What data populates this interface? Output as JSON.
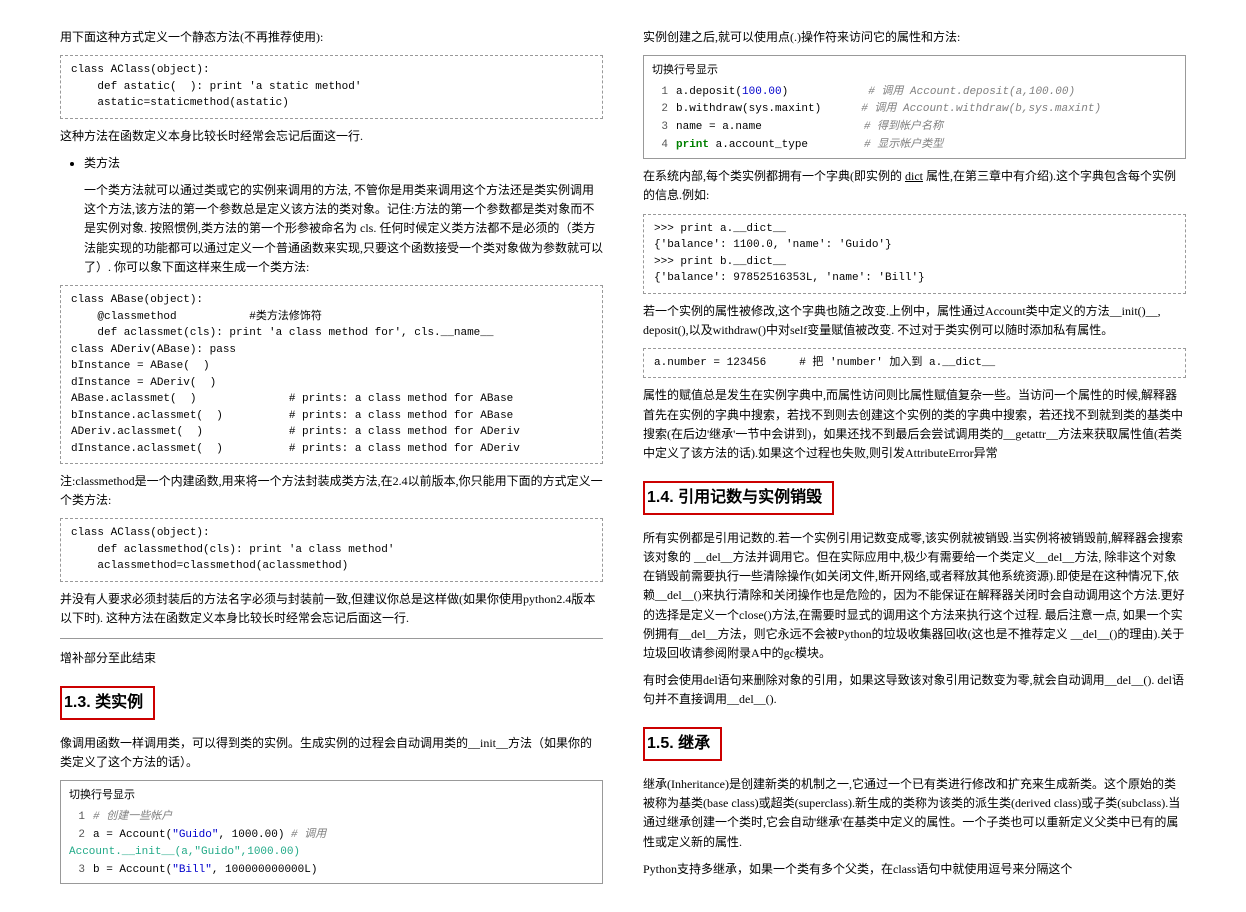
{
  "left": {
    "p1": "用下面这种方式定义一个静态方法(不再推荐使用):",
    "code1": "class AClass(object):\n    def astatic(  ): print 'a static method'\n    astatic=staticmethod(astatic)",
    "p2": "这种方法在函数定义本身比较长时经常会忘记后面这一行.",
    "li1": "类方法",
    "sub1": "一个类方法就可以通过类或它的实例来调用的方法, 不管你是用类来调用这个方法还是类实例调用这个方法,该方法的第一个参数总是定义该方法的类对象。记住:方法的第一个参数都是类对象而不是实例对象. 按照惯例,类方法的第一个形参被命名为 cls. 任何时候定义类方法都不是必须的（类方法能实现的功能都可以通过定义一个普通函数来实现,只要这个函数接受一个类对象做为参数就可以了）. 你可以象下面这样来生成一个类方法:",
    "code2": "class ABase(object):\n    @classmethod           #类方法修饰符\n    def aclassmet(cls): print 'a class method for', cls.__name__\nclass ADeriv(ABase): pass\nbInstance = ABase(  )\ndInstance = ADeriv(  )\nABase.aclassmet(  )              # prints: a class method for ABase\nbInstance.aclassmet(  )          # prints: a class method for ABase\nADeriv.aclassmet(  )             # prints: a class method for ADeriv\ndInstance.aclassmet(  )          # prints: a class method for ADeriv",
    "p3": "注:classmethod是一个内建函数,用来将一个方法封装成类方法,在2.4以前版本,你只能用下面的方式定义一个类方法:",
    "code3": "class AClass(object):\n    def aclassmethod(cls): print 'a class method'\n    aclassmethod=classmethod(aclassmethod)",
    "p4": "并没有人要求必须封装后的方法名字必须与封装前一致,但建议你总是这样做(如果你使用python2.4版本以下时). 这种方法在函数定义本身比较长时经常会忘记后面这一行.",
    "p5": "增补部分至此结束",
    "h13": "1.3. 类实例",
    "p6": "像调用函数一样调用类，可以得到类的实例。生成实例的过程会自动调用类的__init__方法（如果你的类定义了这个方法的话）。",
    "code4title": "切换行号显示",
    "code4": {
      "l1": "# 创建一些帐户",
      "l2a": "a = Account(",
      "l2b": "\"Guido\"",
      "l2c": ", 1000.00)",
      "l2d": "     # 调用",
      "l2x": "Account.__init__(a,\"Guido\",1000.00)",
      "l3a": "b = Account(",
      "l3b": "\"Bill\"",
      "l3c": ", 100000000000L)"
    }
  },
  "right": {
    "p1": "实例创建之后,就可以使用点(.)操作符来访问它的属性和方法:",
    "code1title": "切换行号显示",
    "code1": {
      "l1a": "a.deposit(100.00)",
      "l1b": "# 调用 Account.deposit(a,100.00)",
      "l2a": "b.withdraw(sys.maxint)",
      "l2b": "# 调用 Account.withdraw(b,sys.maxint)",
      "l3a": "name = a.name",
      "l3b": "# 得到帐户名称",
      "l4a": "print a.account_type",
      "l4b": "# 显示帐户类型"
    },
    "p2a": "在系统内部,每个类实例都拥有一个字典(即实例的 ",
    "p2u": "dict",
    "p2b": " 属性,在第三章中有介绍).这个字典包含每个实例的信息.例如:",
    "code2": ">>> print a.__dict__\n{'balance': 1100.0, 'name': 'Guido'}\n>>> print b.__dict__\n{'balance': 97852516353L, 'name': 'Bill'}",
    "p3": "若一个实例的属性被修改,这个字典也随之改变.上例中，属性通过Account类中定义的方法__init()__, deposit(),以及withdraw()中对self变量赋值被改变. 不过对于类实例可以随时添加私有属性。",
    "code3": "a.number = 123456     # 把 'number' 加入到 a.__dict__",
    "p4": "属性的赋值总是发生在实例字典中,而属性访问则比属性赋值复杂一些。当访问一个属性的时候,解释器首先在实例的字典中搜索，若找不到则去创建这个实例的类的字典中搜索，若还找不到就到类的基类中搜索(在后边'继承'一节中会讲到)，如果还找不到最后会尝试调用类的__getattr__方法来获取属性值(若类中定义了该方法的话).如果这个过程也失败,则引发AttributeError异常",
    "h14": "1.4. 引用记数与实例销毁",
    "p5": "所有实例都是引用记数的.若一个实例引用记数变成零,该实例就被销毁.当实例将被销毁前,解释器会搜索该对象的 __del__方法并调用它。但在实际应用中,极少有需要给一个类定义__del__方法, 除非这个对象在销毁前需要执行一些清除操作(如关闭文件,断开网络,或者释放其他系统资源).即使是在这种情况下,依赖__del__()来执行清除和关闭操作也是危险的，因为不能保证在解释器关闭时会自动调用这个方法.更好的选择是定义一个close()方法,在需要时显式的调用这个方法来执行这个过程. 最后注意一点, 如果一个实例拥有__del__方法，则它永远不会被Python的垃圾收集器回收(这也是不推荐定义 __del__()的理由).关于垃圾回收请参阅附录A中的gc模块。",
    "p6": "有时会使用del语句来删除对象的引用，如果这导致该对象引用记数变为零,就会自动调用__del__(). del语句并不直接调用__del__().",
    "h15": "1.5. 继承",
    "p7": "继承(Inheritance)是创建新类的机制之一,它通过一个已有类进行修改和扩充来生成新类。这个原始的类被称为基类(base class)或超类(superclass).新生成的类称为该类的派生类(derived class)或子类(subclass).当通过继承创建一个类时,它会自动'继承'在基类中定义的属性。一个子类也可以重新定义父类中已有的属性或定义新的属性.",
    "p8": "Python支持多继承，如果一个类有多个父类，在class语句中就使用逗号来分隔这个"
  }
}
